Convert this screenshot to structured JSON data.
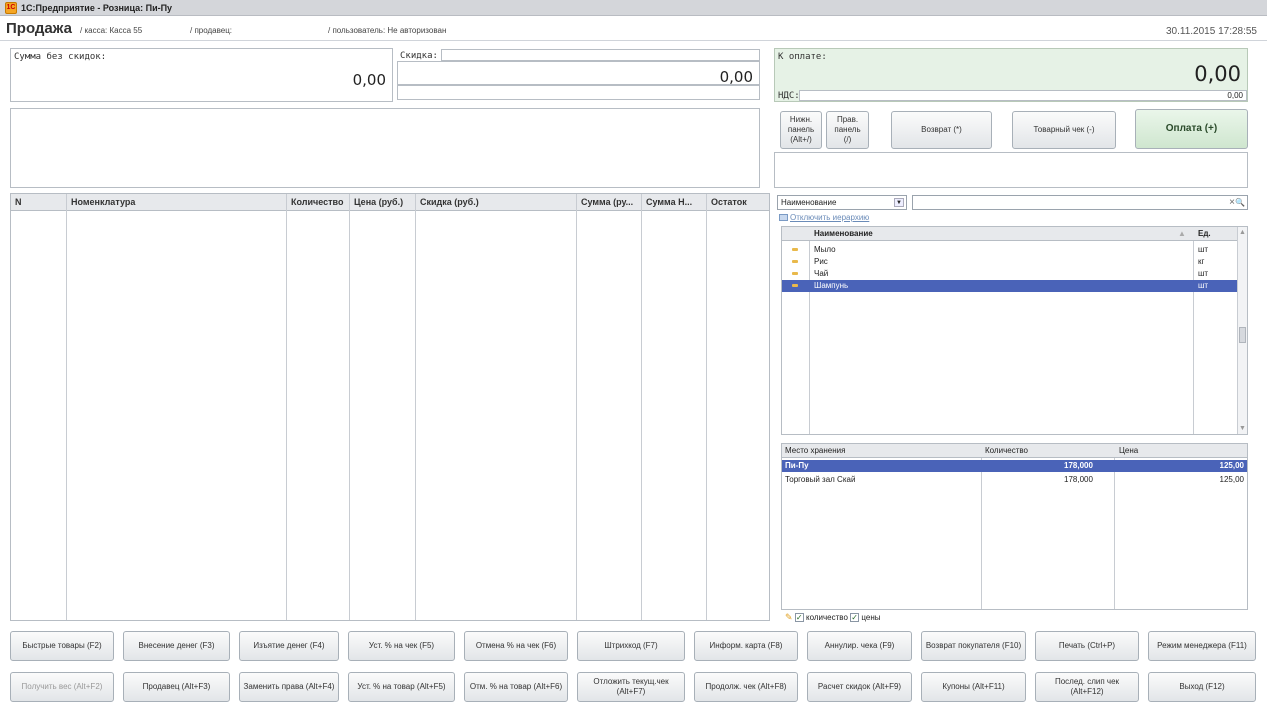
{
  "window": {
    "title": "1С:Предприятие - Розница: Пи-Пу"
  },
  "header": {
    "title": "Продажа",
    "kassa": "/ касса: Касса 55",
    "prodavec": "/ продавец:",
    "user": "/ пользователь: Не авторизован",
    "datetime": "30.11.2015 17:28:55"
  },
  "totals": {
    "sum_label": "Сумма без скидок:",
    "sum_value": "0,00",
    "discount_label": "Скидка:",
    "discount_value": "0,00",
    "pay_label": "К оплате:",
    "pay_value": "0,00",
    "vat_label": "НДС:",
    "vat_value": "0,00"
  },
  "top_buttons": {
    "lower_panel": "Нижн. панель (Alt+/)",
    "right_panel": "Прав. панель (/)",
    "return": "Возврат (*)",
    "goods_receipt": "Товарный чек (-)",
    "payment": "Оплата (+)"
  },
  "receipt_table": {
    "columns": [
      "N",
      "Номенклатура",
      "Количество",
      "Цена (руб.)",
      "Скидка (руб.)",
      "Сумма (ру...",
      "Сумма Н...",
      "Остаток"
    ]
  },
  "search": {
    "field_select": "Наименование",
    "hierarchy_link": "Отключить иерархию",
    "clear_icon": "×",
    "search_icon": "🔍"
  },
  "items": {
    "columns": [
      "Наименование",
      "Ед."
    ],
    "rows": [
      {
        "name": "Мыло",
        "unit": "шт"
      },
      {
        "name": "Рис",
        "unit": "кг"
      },
      {
        "name": "Чай",
        "unit": "шт"
      },
      {
        "name": "Шампунь",
        "unit": "шт"
      }
    ],
    "selected_index": 3
  },
  "stock": {
    "columns": [
      "Место хранения",
      "Количество",
      "Цена"
    ],
    "rows": [
      {
        "place": "Пи-Пу",
        "qty": "178,000",
        "price": "125,00"
      },
      {
        "place": "Торговый зал Скай",
        "qty": "178,000",
        "price": "125,00"
      }
    ],
    "chk_qty": "количество",
    "chk_price": "цены"
  },
  "bottom_buttons": {
    "row1": [
      "Быстрые товары (F2)",
      "Внесение денег (F3)",
      "Изъятие денег (F4)",
      "Уст. % на чек (F5)",
      "Отмена % на чек (F6)",
      "Штрихкод (F7)",
      "Информ. карта (F8)",
      "Аннулир. чека (F9)",
      "Возврат покупателя (F10)",
      "Печать (Ctrl+P)",
      "Режим менеджера (F11)"
    ],
    "row2": [
      "Получить вес (Alt+F2)",
      "Продавец (Alt+F3)",
      "Заменить права (Alt+F4)",
      "Уст. % на товар (Alt+F5)",
      "Отм. % на товар (Alt+F6)",
      "Отложить текущ.чек (Alt+F7)",
      "Продолж. чек (Alt+F8)",
      "Расчет скидок (Alt+F9)",
      "Купоны (Alt+F11)",
      "Послед. слип чек (Alt+F12)",
      "Выход (F12)"
    ]
  }
}
